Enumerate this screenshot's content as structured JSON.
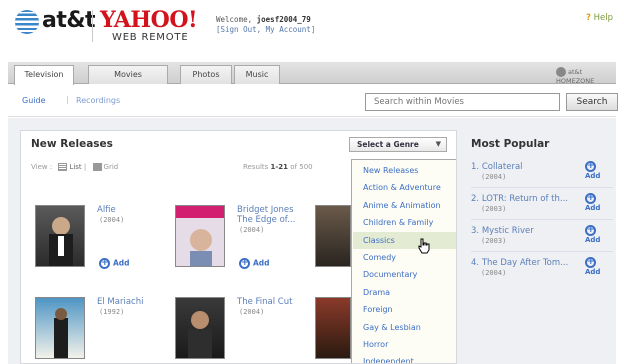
{
  "brand": {
    "att": "at&t",
    "yahoo": "YAHOO!",
    "product": "WEB REMOTE"
  },
  "header": {
    "welcome_prefix": "Welcome,",
    "username": "joesf2004_79",
    "account_links": "[Sign Out, My Account]",
    "help": "Help"
  },
  "tabs": [
    {
      "label": "Television"
    },
    {
      "label": "Movies"
    },
    {
      "label": "Photos"
    },
    {
      "label": "Music"
    }
  ],
  "homezone": "at&t HOMEZONE",
  "subnav": {
    "guide": "Guide",
    "separator": "|",
    "recordings": "Recordings"
  },
  "search": {
    "placeholder": "Search within Movies",
    "button": "Search"
  },
  "new_releases": {
    "title": "New Releases",
    "genre_select": "Select a Genre",
    "view_label": "View :",
    "list_label": "List",
    "divider": "|",
    "grid_label": "Grid",
    "results_prefix": "Results",
    "results_range": "1-21",
    "results_suffix": "of 500",
    "add_label": "Add",
    "movies": [
      {
        "title": "Alfie",
        "title2": "",
        "year": "(2004)"
      },
      {
        "title": "Bridget Jones",
        "title2": "The Edge of...",
        "year": "(2004)"
      },
      {
        "title": "El Mariachi",
        "title2": "",
        "year": "(1992)"
      },
      {
        "title": "The Final Cut",
        "title2": "",
        "year": "(2004)"
      }
    ]
  },
  "genres": [
    "New Releases",
    "Action & Adventure",
    "Anime & Animation",
    "Children & Family",
    "Classics",
    "Comedy",
    "Documentary",
    "Drama",
    "Foreign",
    "Gay & Lesbian",
    "Horror",
    "Independent"
  ],
  "selected_genre": "Classics",
  "most_popular": {
    "title": "Most Popular",
    "add_label": "Add",
    "items": [
      {
        "rank": "1.",
        "title": "Collateral",
        "year": "(2004)"
      },
      {
        "rank": "2.",
        "title": "LOTR: Return of th...",
        "year": "(2003)"
      },
      {
        "rank": "3.",
        "title": "Mystic River",
        "year": "(2003)"
      },
      {
        "rank": "4.",
        "title": "The Day After Tom...",
        "year": "(2004)"
      }
    ]
  },
  "colors": {
    "link_blue": "#3d6ec5",
    "yahoo_red": "#d3131c",
    "help_green": "#7a9c3a",
    "dropdown_highlight": "#e3ebd2"
  }
}
